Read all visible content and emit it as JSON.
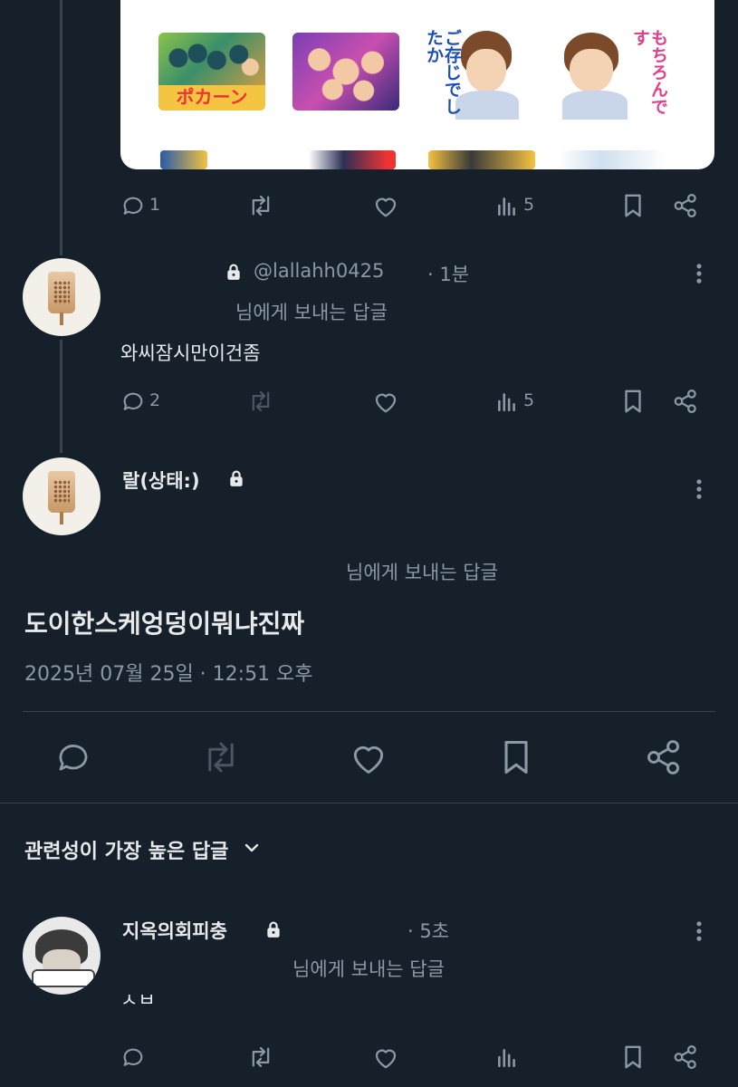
{
  "top_post": {
    "actions": {
      "reply_count": "1",
      "view_count": "5"
    },
    "stickers": [
      {
        "text": "ポカーン"
      },
      {
        "text": ""
      },
      {
        "text": "ご存じでしたか"
      },
      {
        "text": "もちろんです"
      }
    ]
  },
  "reply1": {
    "handle": "@lallahh0425",
    "time": "· 1분",
    "reply_to": "님에게 보내는 답글",
    "text": "와씨잠시만이건좀",
    "actions": {
      "reply_count": "2",
      "view_count": "5"
    }
  },
  "main_post": {
    "author": "랄(상태:)",
    "reply_to": "님에게 보내는 답글",
    "text": "도이한스케엉덩이뭐냐진짜",
    "timestamp": "2025년 07월 25일 · 12:51 오후"
  },
  "sort": {
    "label": "관련성이 가장 높은 답글"
  },
  "reply2": {
    "author": "지옥의회피충",
    "time": "· 5초",
    "reply_to": "님에게 보내는 답글",
    "text": "ㅅㅂ"
  },
  "icons": {
    "reply": "speech-bubble-icon",
    "repost": "repost-arrows-icon",
    "like": "heart-icon",
    "views": "bar-chart-icon",
    "bookmark": "bookmark-icon",
    "share": "share-nodes-icon",
    "more": "more-vertical-icon",
    "lock": "lock-icon",
    "chevron": "chevron-down-icon"
  },
  "colors": {
    "background": "#15202b",
    "text": "#e7e9ea",
    "muted": "#8b98a5",
    "divider": "#38444d"
  }
}
